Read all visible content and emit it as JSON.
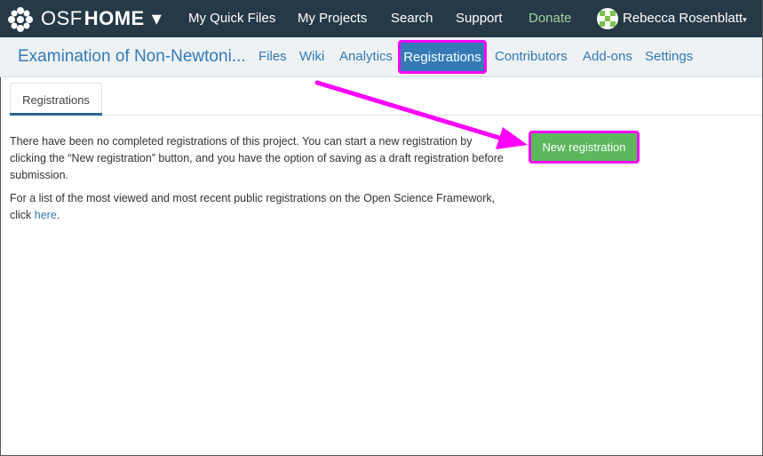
{
  "topnav": {
    "brand_osf": "OSF",
    "brand_home": "HOME",
    "brand_caret": "▾",
    "links": [
      "My Quick Files",
      "My Projects",
      "Search",
      "Support",
      "Donate"
    ],
    "user_name": "Rebecca Rosenblatt",
    "user_caret": "▾"
  },
  "projnav": {
    "title": "Examination of Non-Newtoni...",
    "links": [
      "Files",
      "Wiki",
      "Analytics",
      "Registrations",
      "Contributors",
      "Add-ons",
      "Settings"
    ]
  },
  "tabs": {
    "active": "Registrations"
  },
  "content": {
    "para1": "There have been no completed registrations of this project. You can start a new registration by clicking the “New registration” button, and you have the option of saving as a draft registration before submission.",
    "para2_before": "For a list of the most viewed and most recent public registrations on the Open Science Framework, click ",
    "para2_link": "here",
    "para2_after": "."
  },
  "buttons": {
    "new_registration": "New registration"
  },
  "colors": {
    "topnav_bg": "#263947",
    "accent": "#337ab7",
    "highlight": "#ff00ff",
    "success": "#5cb85c",
    "donate": "#9ed59a"
  }
}
